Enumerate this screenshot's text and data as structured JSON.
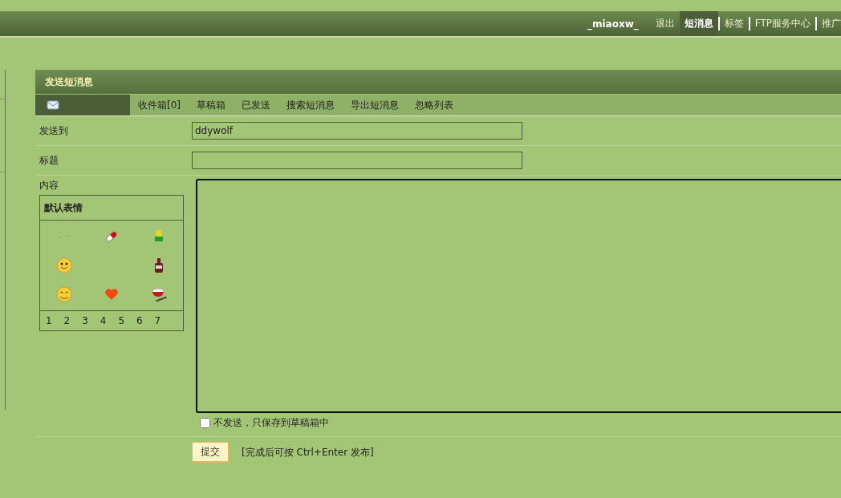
{
  "top_nav": {
    "user": "_miaoxw_",
    "items": [
      {
        "label": "退出",
        "selected": false
      },
      {
        "label": "短消息",
        "selected": true
      },
      {
        "label": "标签",
        "selected": false
      },
      {
        "label": "FTP服务中心",
        "selected": false
      },
      {
        "label": "推广",
        "selected": false
      }
    ]
  },
  "panel": {
    "title": "发送短消息",
    "tabs": [
      {
        "kind": "icon",
        "selected": true
      },
      {
        "kind": "text",
        "label": "收件箱[0]",
        "selected": false
      },
      {
        "kind": "text",
        "label": "草稿箱",
        "selected": false
      },
      {
        "kind": "text",
        "label": "已发送",
        "selected": false
      },
      {
        "kind": "text",
        "label": "搜索短消息",
        "selected": false
      },
      {
        "kind": "text",
        "label": "导出短消息",
        "selected": false
      },
      {
        "kind": "text",
        "label": "忽略列表",
        "selected": false
      }
    ]
  },
  "form": {
    "to_label": "发送到",
    "to_value": "ddywolf",
    "subject_label": "标题",
    "content_label": "内容",
    "smilies": {
      "title": "默认表情",
      "pages": [
        "1",
        "2",
        "3",
        "4",
        "5",
        "6",
        "7"
      ]
    },
    "save_only": {
      "label": "不发送，只保存到草稿箱中",
      "checked": false
    },
    "submit": "提交",
    "hint": "[完成后可按 Ctrl+Enter 发布]"
  }
}
